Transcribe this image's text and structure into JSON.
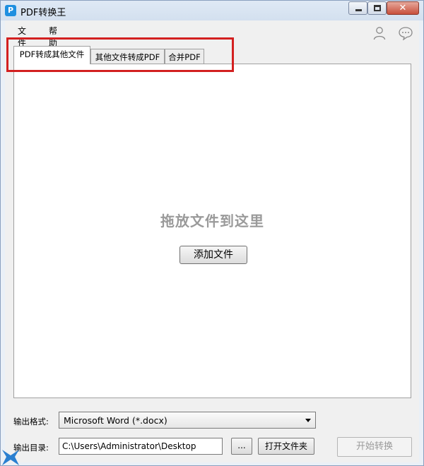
{
  "window": {
    "title": "PDF转换王",
    "app_icon": "P",
    "controls": {
      "minimize": "minimize-icon",
      "maximize": "maximize-icon",
      "close": "close-icon",
      "close_glyph": "✕"
    }
  },
  "menu": {
    "file": "文件",
    "help": "帮助"
  },
  "header_icons": {
    "user": "user-icon",
    "chat": "chat-icon"
  },
  "tabs": [
    {
      "label": "PDF转成其他文件",
      "active": true
    },
    {
      "label": "其他文件转成PDF",
      "active": false
    },
    {
      "label": "合并PDF",
      "active": false
    }
  ],
  "drop_area": {
    "hint": "拖放文件到这里",
    "add_button": "添加文件"
  },
  "output": {
    "format_label": "输出格式:",
    "format_value": "Microsoft Word (*.docx)",
    "dir_label": "输出目录:",
    "dir_value": "C:\\Users\\Administrator\\Desktop",
    "browse_label": "...",
    "open_folder_label": "打开文件夹"
  },
  "start_button": "开始转换",
  "colors": {
    "highlight": "#d32020",
    "app_icon": "#1e8fe0",
    "hint_text": "#9a9a9a"
  }
}
